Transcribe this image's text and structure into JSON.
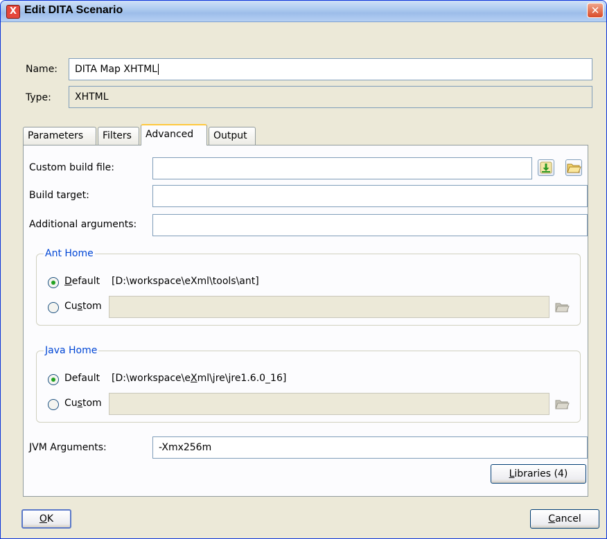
{
  "window": {
    "title": "Edit DITA Scenario",
    "app_icon_glyph": "X",
    "close_glyph": "✕"
  },
  "form": {
    "name_label": "Name:",
    "name_value": "DITA Map XHTML",
    "type_label": "Type:",
    "type_value": "XHTML"
  },
  "tabs": [
    {
      "label": "Parameters",
      "active": false
    },
    {
      "label": "Filters",
      "active": false
    },
    {
      "label": "Advanced",
      "active": true
    },
    {
      "label": "Output",
      "active": false
    }
  ],
  "advanced": {
    "custom_build_file_label": "Custom build file:",
    "custom_build_file_value": "",
    "build_target_label": "Build target:",
    "build_target_value": "",
    "additional_arguments_label": "Additional arguments:",
    "additional_arguments_value": "",
    "ant_home": {
      "legend": "Ant Home",
      "default_label_prefix": "",
      "default_label_mn": "D",
      "default_label_rest": "efault",
      "default_path": "[D:\\workspace\\eXml\\tools\\ant]",
      "custom_label_a": "Cu",
      "custom_label_mn": "s",
      "custom_label_b": "tom",
      "custom_value": "",
      "selected": "default"
    },
    "java_home": {
      "legend": "Java Home",
      "default_label": "Default",
      "default_path_a": "[D:\\workspace\\e",
      "default_path_mn": "X",
      "default_path_b": "ml\\jre\\jre1.6.0_16]",
      "custom_label_a": "Cu",
      "custom_label_mn": "s",
      "custom_label_b": "tom",
      "custom_value": "",
      "selected": "default"
    },
    "jvm_arguments_label": "JVM Arguments:",
    "jvm_arguments_value": "-Xmx256m",
    "libraries_button_mn": "L",
    "libraries_button_rest": "ibraries (4)"
  },
  "buttons": {
    "ok_mn": "O",
    "ok_rest": "K",
    "cancel_mn": "C",
    "cancel_rest": "ancel"
  },
  "icons": {
    "download": "download-icon",
    "folder": "folder-open-icon"
  }
}
